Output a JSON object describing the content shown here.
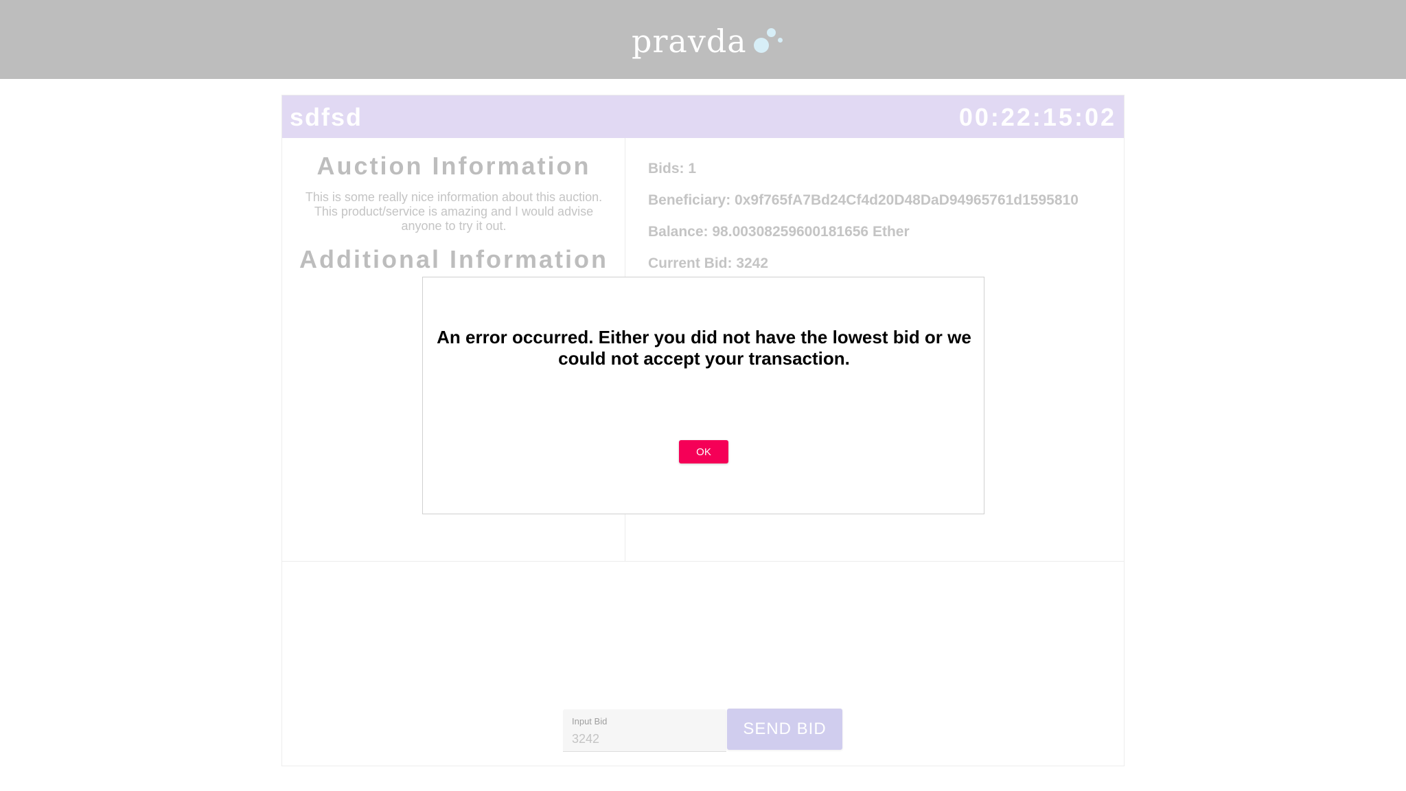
{
  "header": {
    "logo_text": "pravda"
  },
  "auction": {
    "name": "sdfsd",
    "timer": "00:22:15:02",
    "auction_info_title": "Auction Information",
    "auction_info_text": "This is some really nice information about this auction. This product/service is amazing and I would advise anyone to try it out.",
    "additional_info_title": "Additional Information",
    "bids": "Bids: 1",
    "beneficiary": "Beneficiary: 0x9f765fA7Bd24Cf4d20D48DaD94965761d1595810",
    "balance": "Balance: 98.00308259600181656 Ether",
    "current_bid": "Current Bid: 3242"
  },
  "bid_form": {
    "label": "Input Bid",
    "placeholder": "3242",
    "send_label": "SEND BID"
  },
  "dialog": {
    "message": "An error occurred. Either you did not have the lowest bid or we could not accept your transaction.",
    "ok_label": "OK"
  },
  "colors": {
    "header_bar": "#bdbdbd",
    "card_header": "#e1d9f3",
    "send_button": "#d0cdee",
    "ok_button": "#f50057"
  }
}
